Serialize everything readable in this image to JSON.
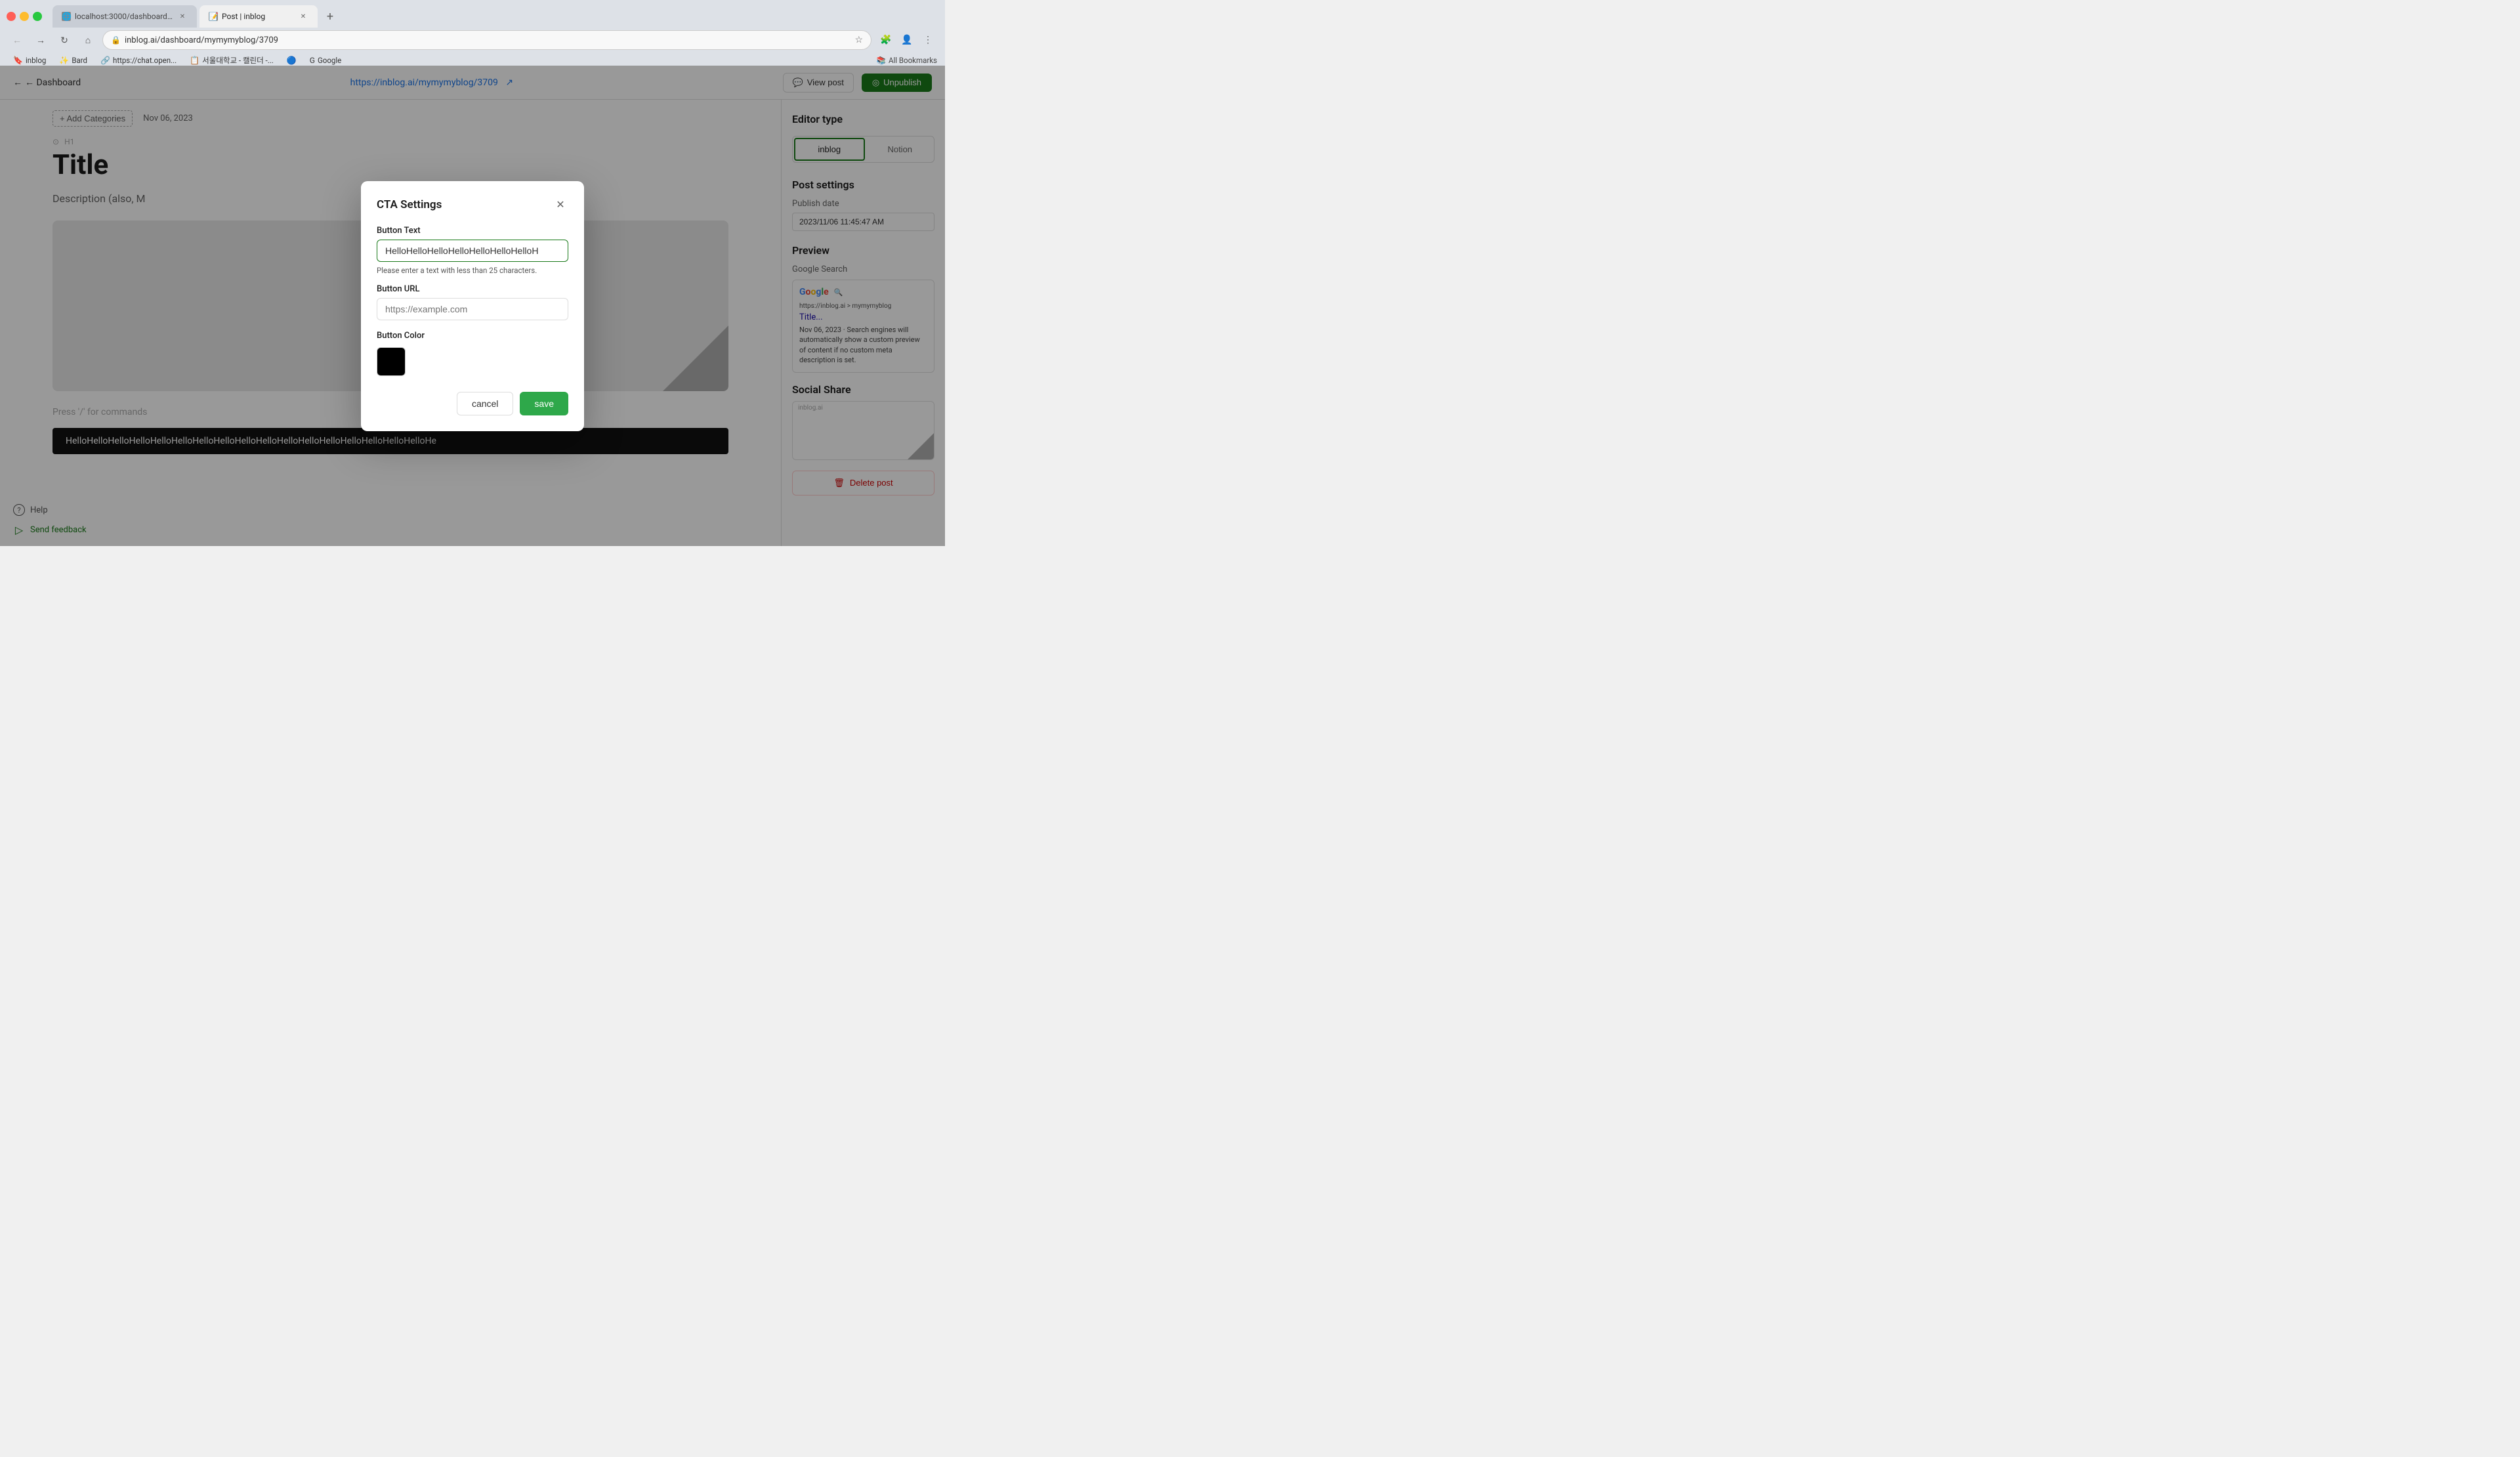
{
  "browser": {
    "tabs": [
      {
        "id": "tab-1",
        "title": "localhost:3000/dashboard/m",
        "favicon": "🌐",
        "active": false,
        "url": "localhost:3000/dashboard/m"
      },
      {
        "id": "tab-2",
        "title": "Post | inblog",
        "favicon": "📝",
        "active": true,
        "url": "Post | inblog"
      }
    ],
    "url": "inblog.ai/dashboard/mymymyblog/3709",
    "bookmarks": [
      {
        "id": "bm-inblog",
        "label": "inblog",
        "icon": "🔖"
      },
      {
        "id": "bm-bard",
        "label": "Bard",
        "icon": "✨"
      },
      {
        "id": "bm-chat",
        "label": "https://chat.open...",
        "icon": "🔗"
      },
      {
        "id": "bm-seoul",
        "label": "서울대학교 - 캘린더 -...",
        "icon": "📋"
      },
      {
        "id": "bm-pi",
        "label": "",
        "icon": "🔵"
      },
      {
        "id": "bm-google",
        "label": "Google",
        "icon": "G"
      }
    ],
    "allBookmarks": "All Bookmarks"
  },
  "app": {
    "header": {
      "backLabel": "← Dashboard",
      "postUrl": "https://inblog.ai/mymymyblog/",
      "postUrlHighlight": "3709",
      "externalLinkIcon": "⬡",
      "viewPostLabel": "View post",
      "unpublishLabel": "Unpublish"
    },
    "editor": {
      "addCategoriesLabel": "+ Add Categories",
      "postDate": "Nov 06, 2023",
      "h1Label": "H1",
      "settingsIcon": "⚙",
      "title": "Title",
      "description": "Description (also, M",
      "pressSlashLabel": "Press '/' for commands",
      "ctaPreviewText": "HelloHelloHelloHelloHelloHelloHelloHelloHelloHelloHelloHelloHelloHelloHelloHelloHelloHe"
    },
    "sidebar": {
      "editorTypeTitle": "Editor type",
      "editorTypes": [
        {
          "id": "inblog",
          "label": "inblog",
          "active": true
        },
        {
          "id": "notion",
          "label": "Notion",
          "active": false
        }
      ],
      "postSettingsTitle": "Post settings",
      "publishDateLabel": "Publish date",
      "publishDateValue": "2023/11/06 11:45:47 AM",
      "previewTitle": "Preview",
      "googleSearchLabel": "Google Search",
      "googlePreview": {
        "urlText": "https://inblog.ai > mymymyblog",
        "titleText": "Title...",
        "snippetText": "Nov 06, 2023 · Search engines will automatically show a custom preview of content if no custom meta description is set."
      },
      "socialShareTitle": "Social Share",
      "inblogAiLabel": "inblog.ai",
      "notionText": "Notion",
      "deletePostLabel": "Delete post"
    },
    "bottomBar": {
      "helpLabel": "Help",
      "feedbackLabel": "Send feedback"
    }
  },
  "modal": {
    "title": "CTA Settings",
    "buttonTextLabel": "Button Text",
    "buttonTextValue": "HelloHelloHelloHelloHelloHelloHelloH",
    "buttonTextError": "Please enter a text with less than 25 characters.",
    "buttonUrlLabel": "Button URL",
    "buttonUrlPlaceholder": "https://example.com",
    "buttonColorLabel": "Button Color",
    "buttonColorValue": "#000000",
    "cancelLabel": "cancel",
    "saveLabel": "save"
  }
}
